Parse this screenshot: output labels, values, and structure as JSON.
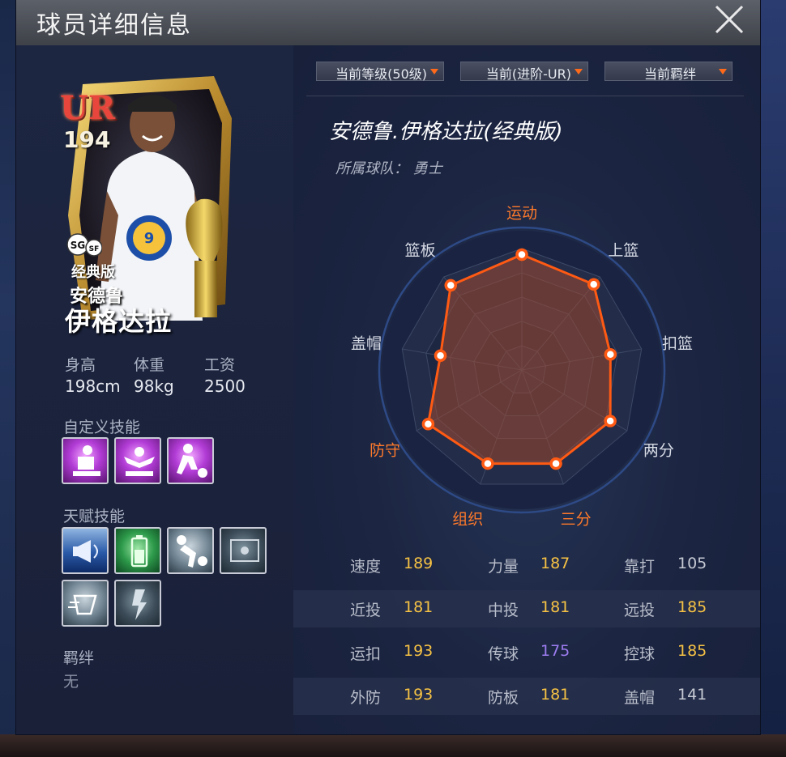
{
  "window": {
    "title": "球员详细信息"
  },
  "card": {
    "rarity": "UR",
    "power": "194",
    "positions": [
      "SG",
      "SF"
    ],
    "edition": "经典版",
    "name_line1": "安德鲁",
    "name_line2": "伊格达拉"
  },
  "attributes": [
    {
      "label": "身高",
      "value": "198cm"
    },
    {
      "label": "体重",
      "value": "98kg"
    },
    {
      "label": "工资",
      "value": "2500"
    }
  ],
  "custom_skills": {
    "label": "自定义技能",
    "icons": [
      "shooting-skill-icon",
      "celebrate-skill-icon",
      "dribble-skill-icon"
    ]
  },
  "talent_skills": {
    "label": "天赋技能",
    "icons": [
      "megaphone-skill-icon",
      "battery-skill-icon",
      "block-skill-icon",
      "board-skill-icon",
      "speed-skill-icon",
      "energy-skill-icon"
    ]
  },
  "bond": {
    "label": "羁绊",
    "value": "无"
  },
  "dropdowns": [
    {
      "label": "当前等级(50级)"
    },
    {
      "label": "当前(进阶-UR)"
    },
    {
      "label": "当前羁绊"
    }
  ],
  "player": {
    "full_name": "安德鲁.伊格达拉(经典版)",
    "team_label": "所属球队：  勇士"
  },
  "chart_data": {
    "type": "radar",
    "axes": [
      "运动",
      "上篮",
      "扣篮",
      "两分",
      "三分",
      "组织",
      "防守",
      "盖帽",
      "篮板"
    ],
    "highlighted_axes": [
      "运动",
      "三分",
      "组织",
      "防守"
    ],
    "values": [
      0.95,
      0.92,
      0.74,
      0.84,
      0.82,
      0.82,
      0.89,
      0.68,
      0.91
    ],
    "range": [
      0,
      1
    ],
    "colors": {
      "line": "#ff5a14",
      "fill": "#a04a30",
      "highlight_label": "#ff7a2a"
    }
  },
  "stats": [
    [
      {
        "label": "速度",
        "value": "189",
        "color": "gold"
      },
      {
        "label": "力量",
        "value": "187",
        "color": "gold"
      },
      {
        "label": "靠打",
        "value": "105",
        "color": "white"
      }
    ],
    [
      {
        "label": "近投",
        "value": "181",
        "color": "gold"
      },
      {
        "label": "中投",
        "value": "181",
        "color": "gold"
      },
      {
        "label": "远投",
        "value": "185",
        "color": "gold"
      }
    ],
    [
      {
        "label": "运扣",
        "value": "193",
        "color": "gold"
      },
      {
        "label": "传球",
        "value": "175",
        "color": "purple"
      },
      {
        "label": "控球",
        "value": "185",
        "color": "gold"
      }
    ],
    [
      {
        "label": "外防",
        "value": "193",
        "color": "gold"
      },
      {
        "label": "防板",
        "value": "181",
        "color": "gold"
      },
      {
        "label": "盖帽",
        "value": "141",
        "color": "white"
      }
    ]
  ]
}
